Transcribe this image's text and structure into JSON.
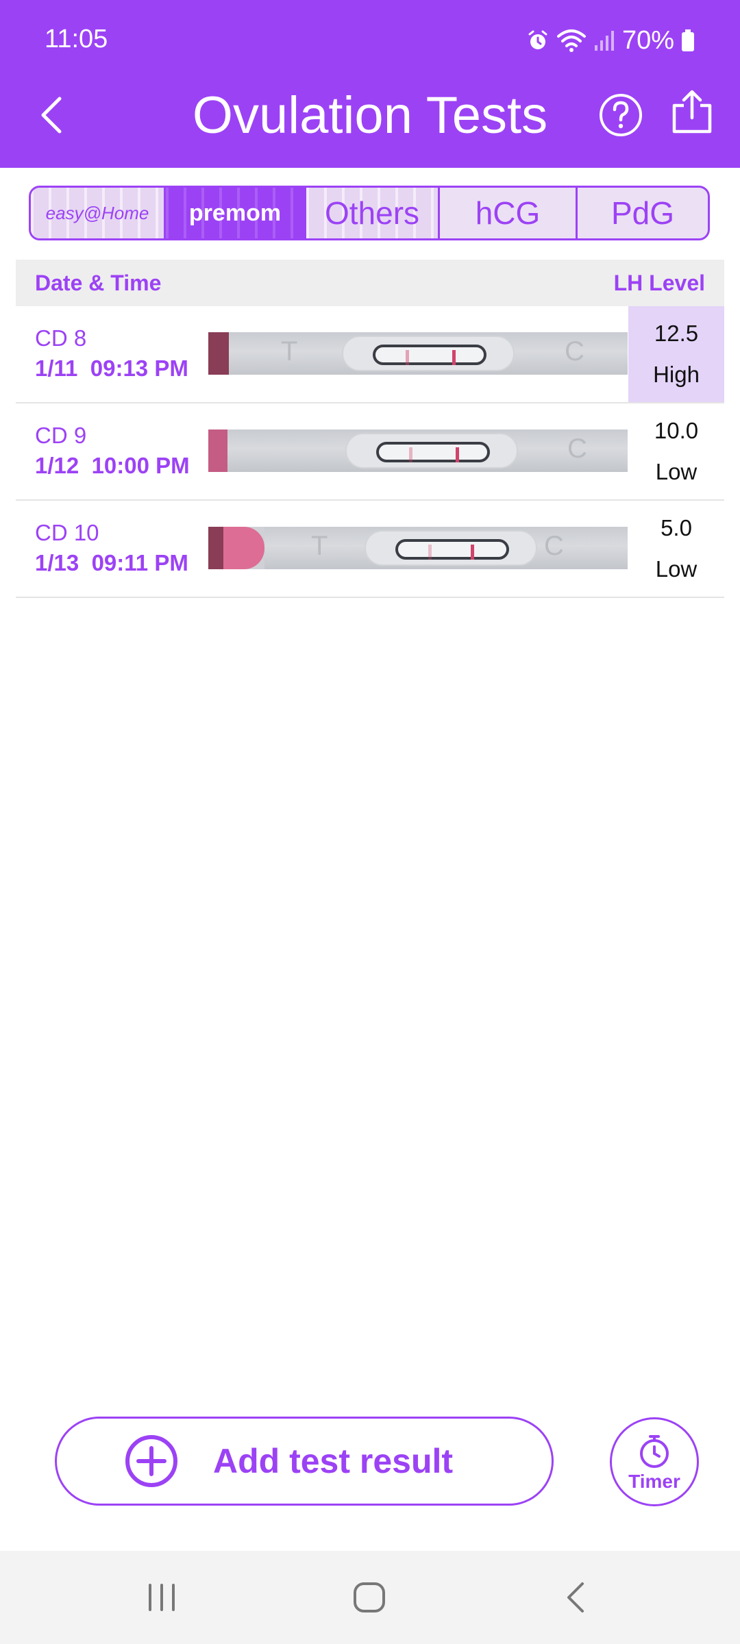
{
  "status_bar": {
    "time": "11:05",
    "battery": "70%",
    "icons": [
      "alarm-icon",
      "wifi-icon",
      "signal-icon",
      "battery-icon"
    ]
  },
  "header": {
    "title": "Ovulation Tests",
    "back_icon": "chevron-left-icon",
    "help_icon": "question-circle-icon",
    "share_icon": "share-icon"
  },
  "tabs": [
    {
      "label": "easy@Home",
      "active": false
    },
    {
      "label": "premom",
      "active": true
    },
    {
      "label": "Others",
      "active": false
    },
    {
      "label": "hCG",
      "active": false
    },
    {
      "label": "PdG",
      "active": false
    }
  ],
  "table": {
    "col_date": "Date & Time",
    "col_level": "LH Level",
    "rows": [
      {
        "cd": "CD 8",
        "datetime": "1/11  09:13 PM",
        "value": "12.5",
        "level": "High",
        "highlight": true
      },
      {
        "cd": "CD 9",
        "datetime": "1/12  10:00 PM",
        "value": "10.0",
        "level": "Low",
        "highlight": false
      },
      {
        "cd": "CD 10",
        "datetime": "1/13  09:11 PM",
        "value": "5.0",
        "level": "Low",
        "highlight": false
      }
    ]
  },
  "actions": {
    "add_label": "Add test result",
    "add_icon": "plus-circle-icon",
    "timer_label": "Timer",
    "timer_icon": "stopwatch-icon"
  },
  "colors": {
    "accent": "#9c42f5",
    "highlight": "#e4d4f8",
    "test_line": "#d0436b"
  },
  "nav_bar": [
    "recents-icon",
    "home-icon",
    "back-icon"
  ]
}
